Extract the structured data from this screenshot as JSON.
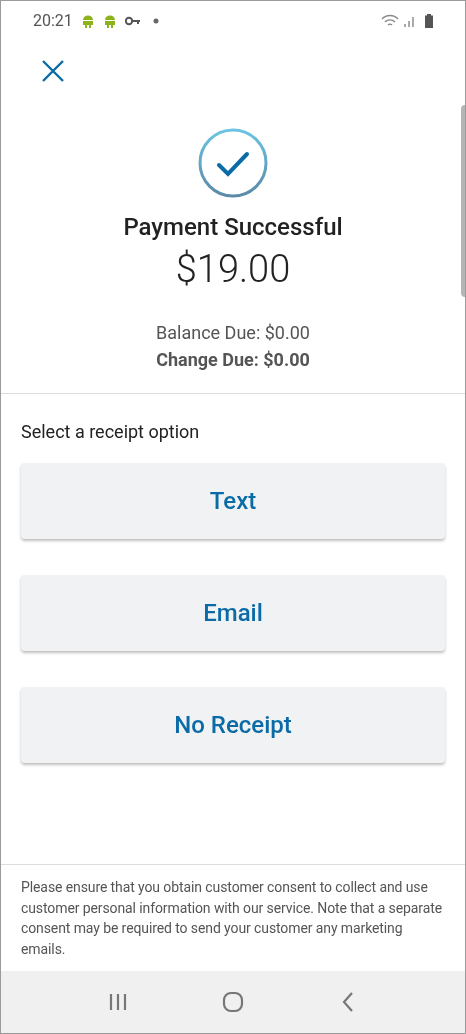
{
  "status_bar": {
    "time": "20:21"
  },
  "title": "Payment Successful",
  "amount": "$19.00",
  "balance_due": "Balance Due: $0.00",
  "change_due": "Change Due: $0.00",
  "receipt_prompt": "Select a receipt option",
  "receipt_options": [
    "Text",
    "Email",
    "No Receipt"
  ],
  "disclaimer": "Please ensure that you obtain customer consent to collect and use customer personal information with our service. Note that a separate consent may be required to send your customer any marketing emails."
}
